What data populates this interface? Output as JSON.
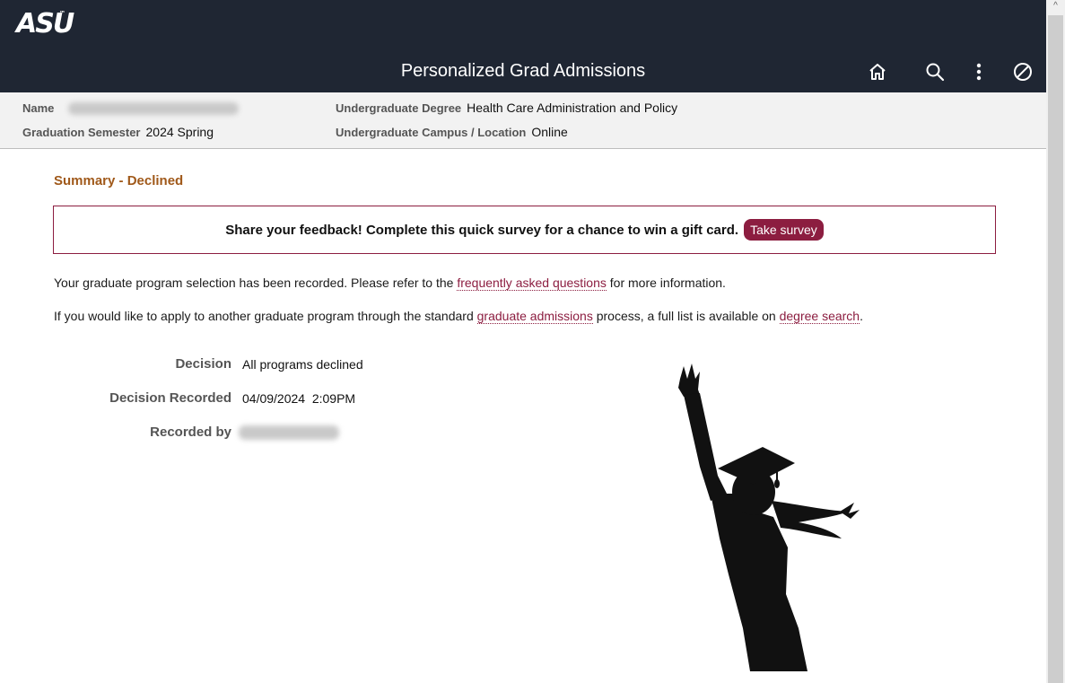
{
  "header": {
    "logo_text": "ASU",
    "logo_tm": "™",
    "title": "Personalized Grad Admissions",
    "icons": [
      "home-icon",
      "search-icon",
      "more-vertical-icon",
      "no-entry-icon"
    ]
  },
  "info": {
    "name_label": "Name",
    "grad_semester_label": "Graduation Semester",
    "grad_semester_value": "2024 Spring",
    "ug_degree_label": "Undergraduate Degree",
    "ug_degree_value": "Health Care Administration and Policy",
    "ug_campus_label": "Undergraduate Campus / Location",
    "ug_campus_value": "Online"
  },
  "summary": {
    "title": "Summary - Declined",
    "survey_text": "Share your feedback! Complete this quick survey for a chance to win a gift card.",
    "survey_button": "Take survey",
    "p1_before": "Your graduate program selection has been recorded. Please refer to the ",
    "p1_link": "frequently asked questions",
    "p1_after": " for more information.",
    "p2_before": "If you would like to apply to another graduate program through the standard ",
    "p2_link1": "graduate admissions",
    "p2_middle": " process, a full list is available on ",
    "p2_link2": "degree search",
    "p2_after": "."
  },
  "fields": {
    "decision_label": "Decision",
    "decision_value": "All programs declined",
    "recorded_label": "Decision Recorded",
    "recorded_value": "04/09/2024  2:09PM",
    "recorded_by_label": "Recorded by"
  },
  "colors": {
    "header_bg": "#1f2633",
    "accent_maroon": "#8c1d40",
    "summary_title": "#a0591a"
  }
}
